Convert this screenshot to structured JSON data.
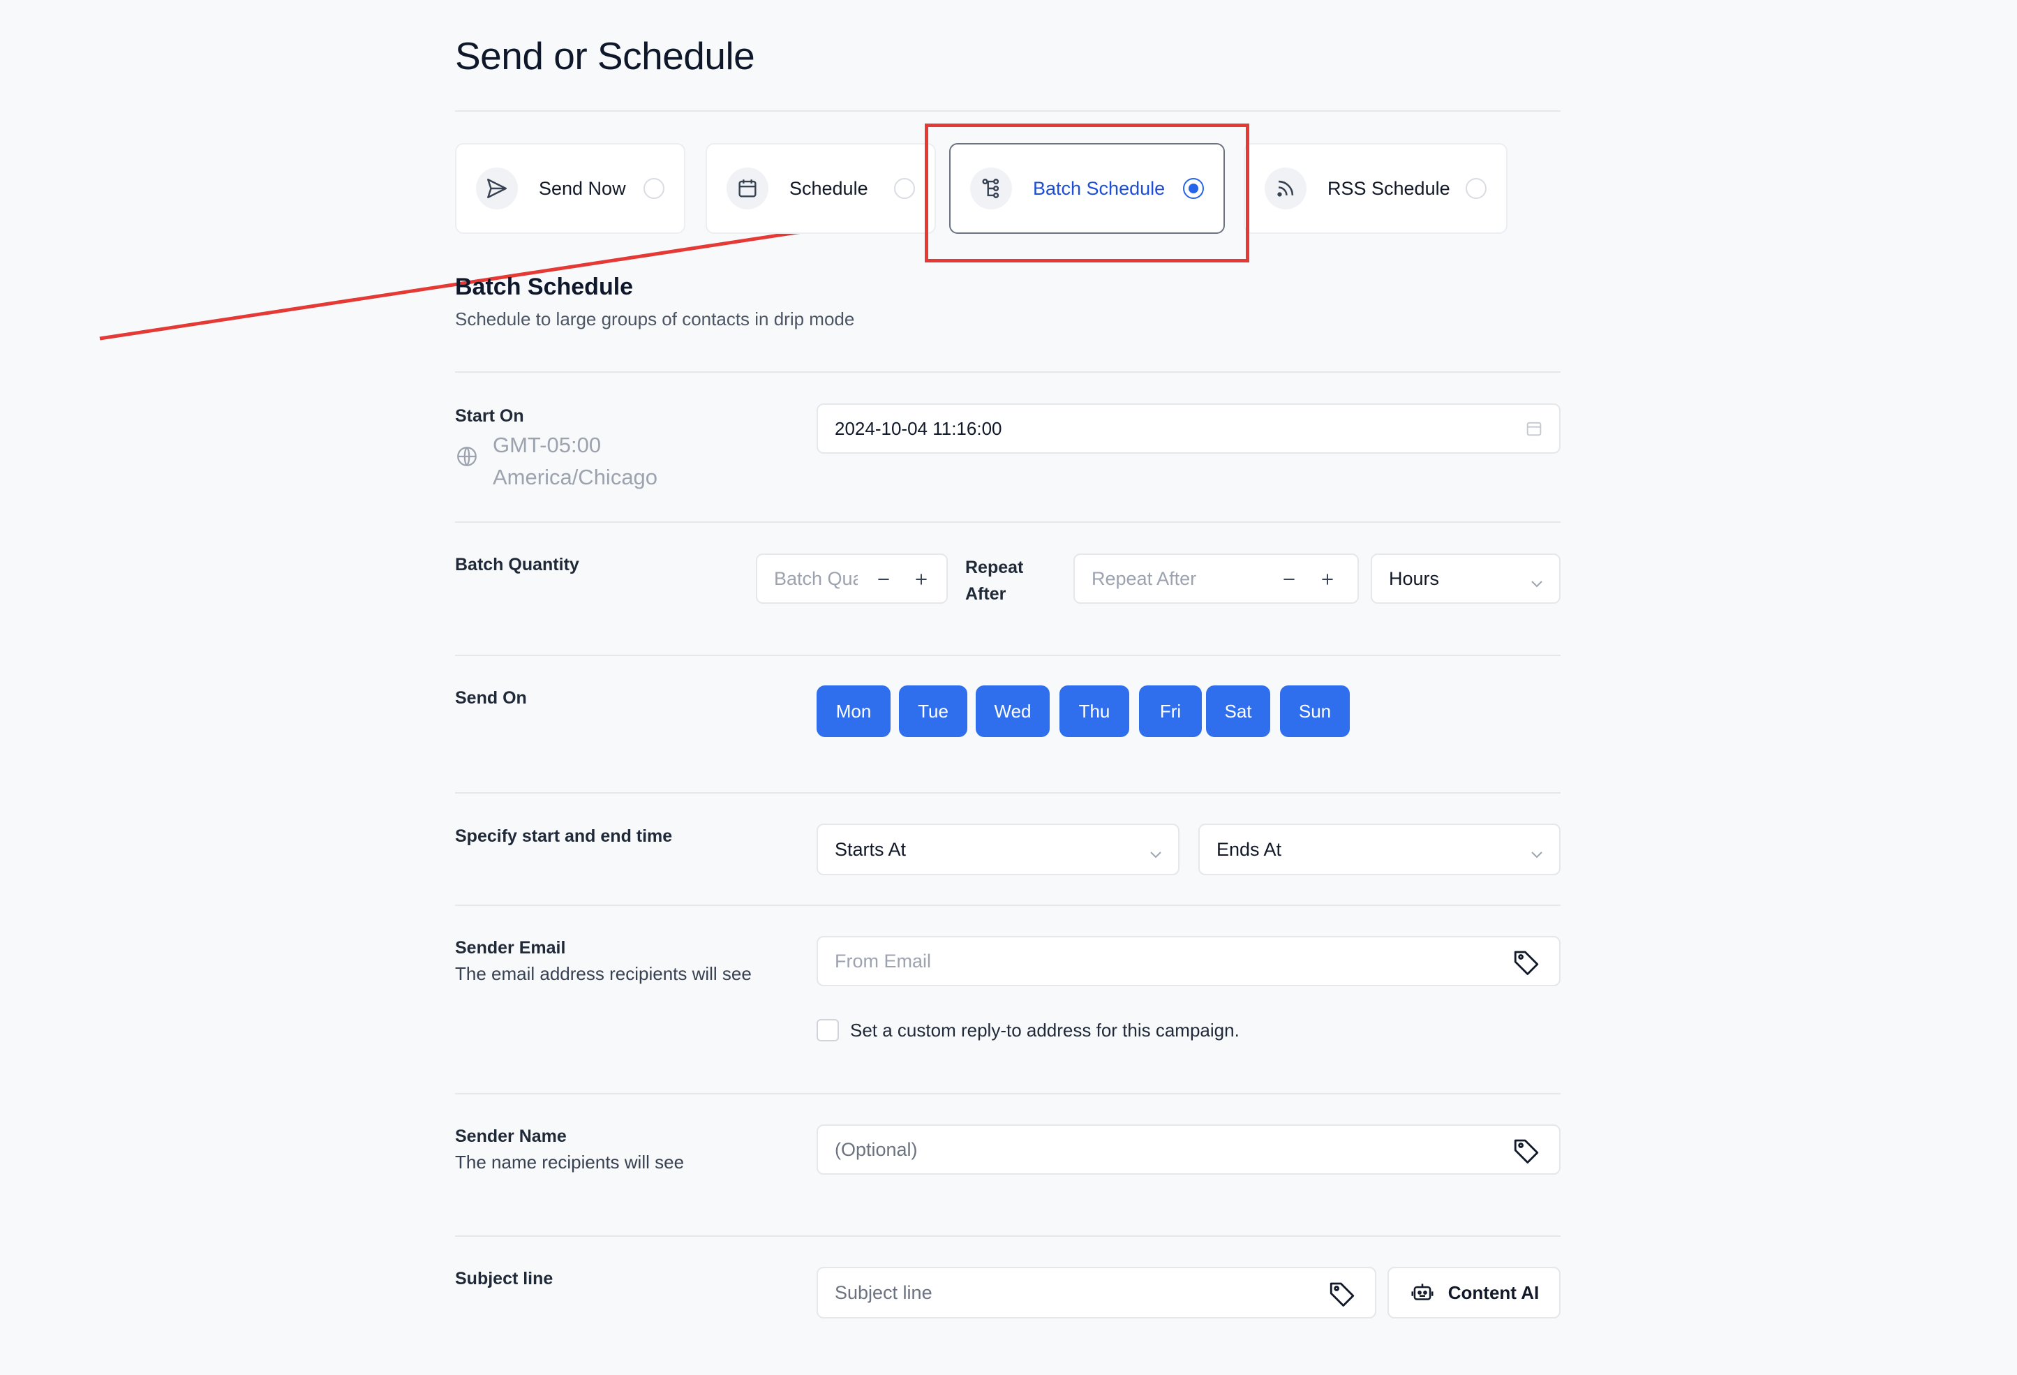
{
  "page": {
    "title": "Send or Schedule"
  },
  "modes": [
    {
      "label": "Send Now",
      "icon": "send-icon",
      "selected": false
    },
    {
      "label": "Schedule",
      "icon": "calendar-icon",
      "selected": false
    },
    {
      "label": "Batch Schedule",
      "icon": "batch-tree-icon",
      "selected": true
    },
    {
      "label": "RSS Schedule",
      "icon": "rss-icon",
      "selected": false
    }
  ],
  "section": {
    "title": "Batch Schedule",
    "subtitle": "Schedule to large groups of contacts in drip mode"
  },
  "start_on": {
    "label": "Start On",
    "tz_offset": "GMT-05:00",
    "tz_name": "America/Chicago",
    "value": "2024-10-04 11:16:00"
  },
  "batch": {
    "label": "Batch Quantity",
    "quantity_placeholder": "Batch Quantity",
    "repeat_label_line1": "Repeat",
    "repeat_label_line2": "After",
    "repeat_placeholder": "Repeat After",
    "unit": "Hours"
  },
  "send_on": {
    "label": "Send On",
    "days": [
      "Mon",
      "Tue",
      "Wed",
      "Thu",
      "Fri",
      "Sat",
      "Sun"
    ]
  },
  "time_range": {
    "label": "Specify start and end time",
    "starts": "Starts At",
    "ends": "Ends At"
  },
  "sender_email": {
    "label": "Sender Email",
    "sub": "The email address recipients will see",
    "placeholder": "From Email",
    "checkbox_label": "Set a custom reply-to address for this campaign.",
    "checked": false
  },
  "sender_name": {
    "label": "Sender Name",
    "sub": "The name recipients will see",
    "placeholder": "(Optional)"
  },
  "subject": {
    "label": "Subject line",
    "placeholder": "Subject line",
    "ai_button": "Content AI"
  },
  "colors": {
    "accent": "#2f6fed",
    "annotation": "#e53935"
  }
}
